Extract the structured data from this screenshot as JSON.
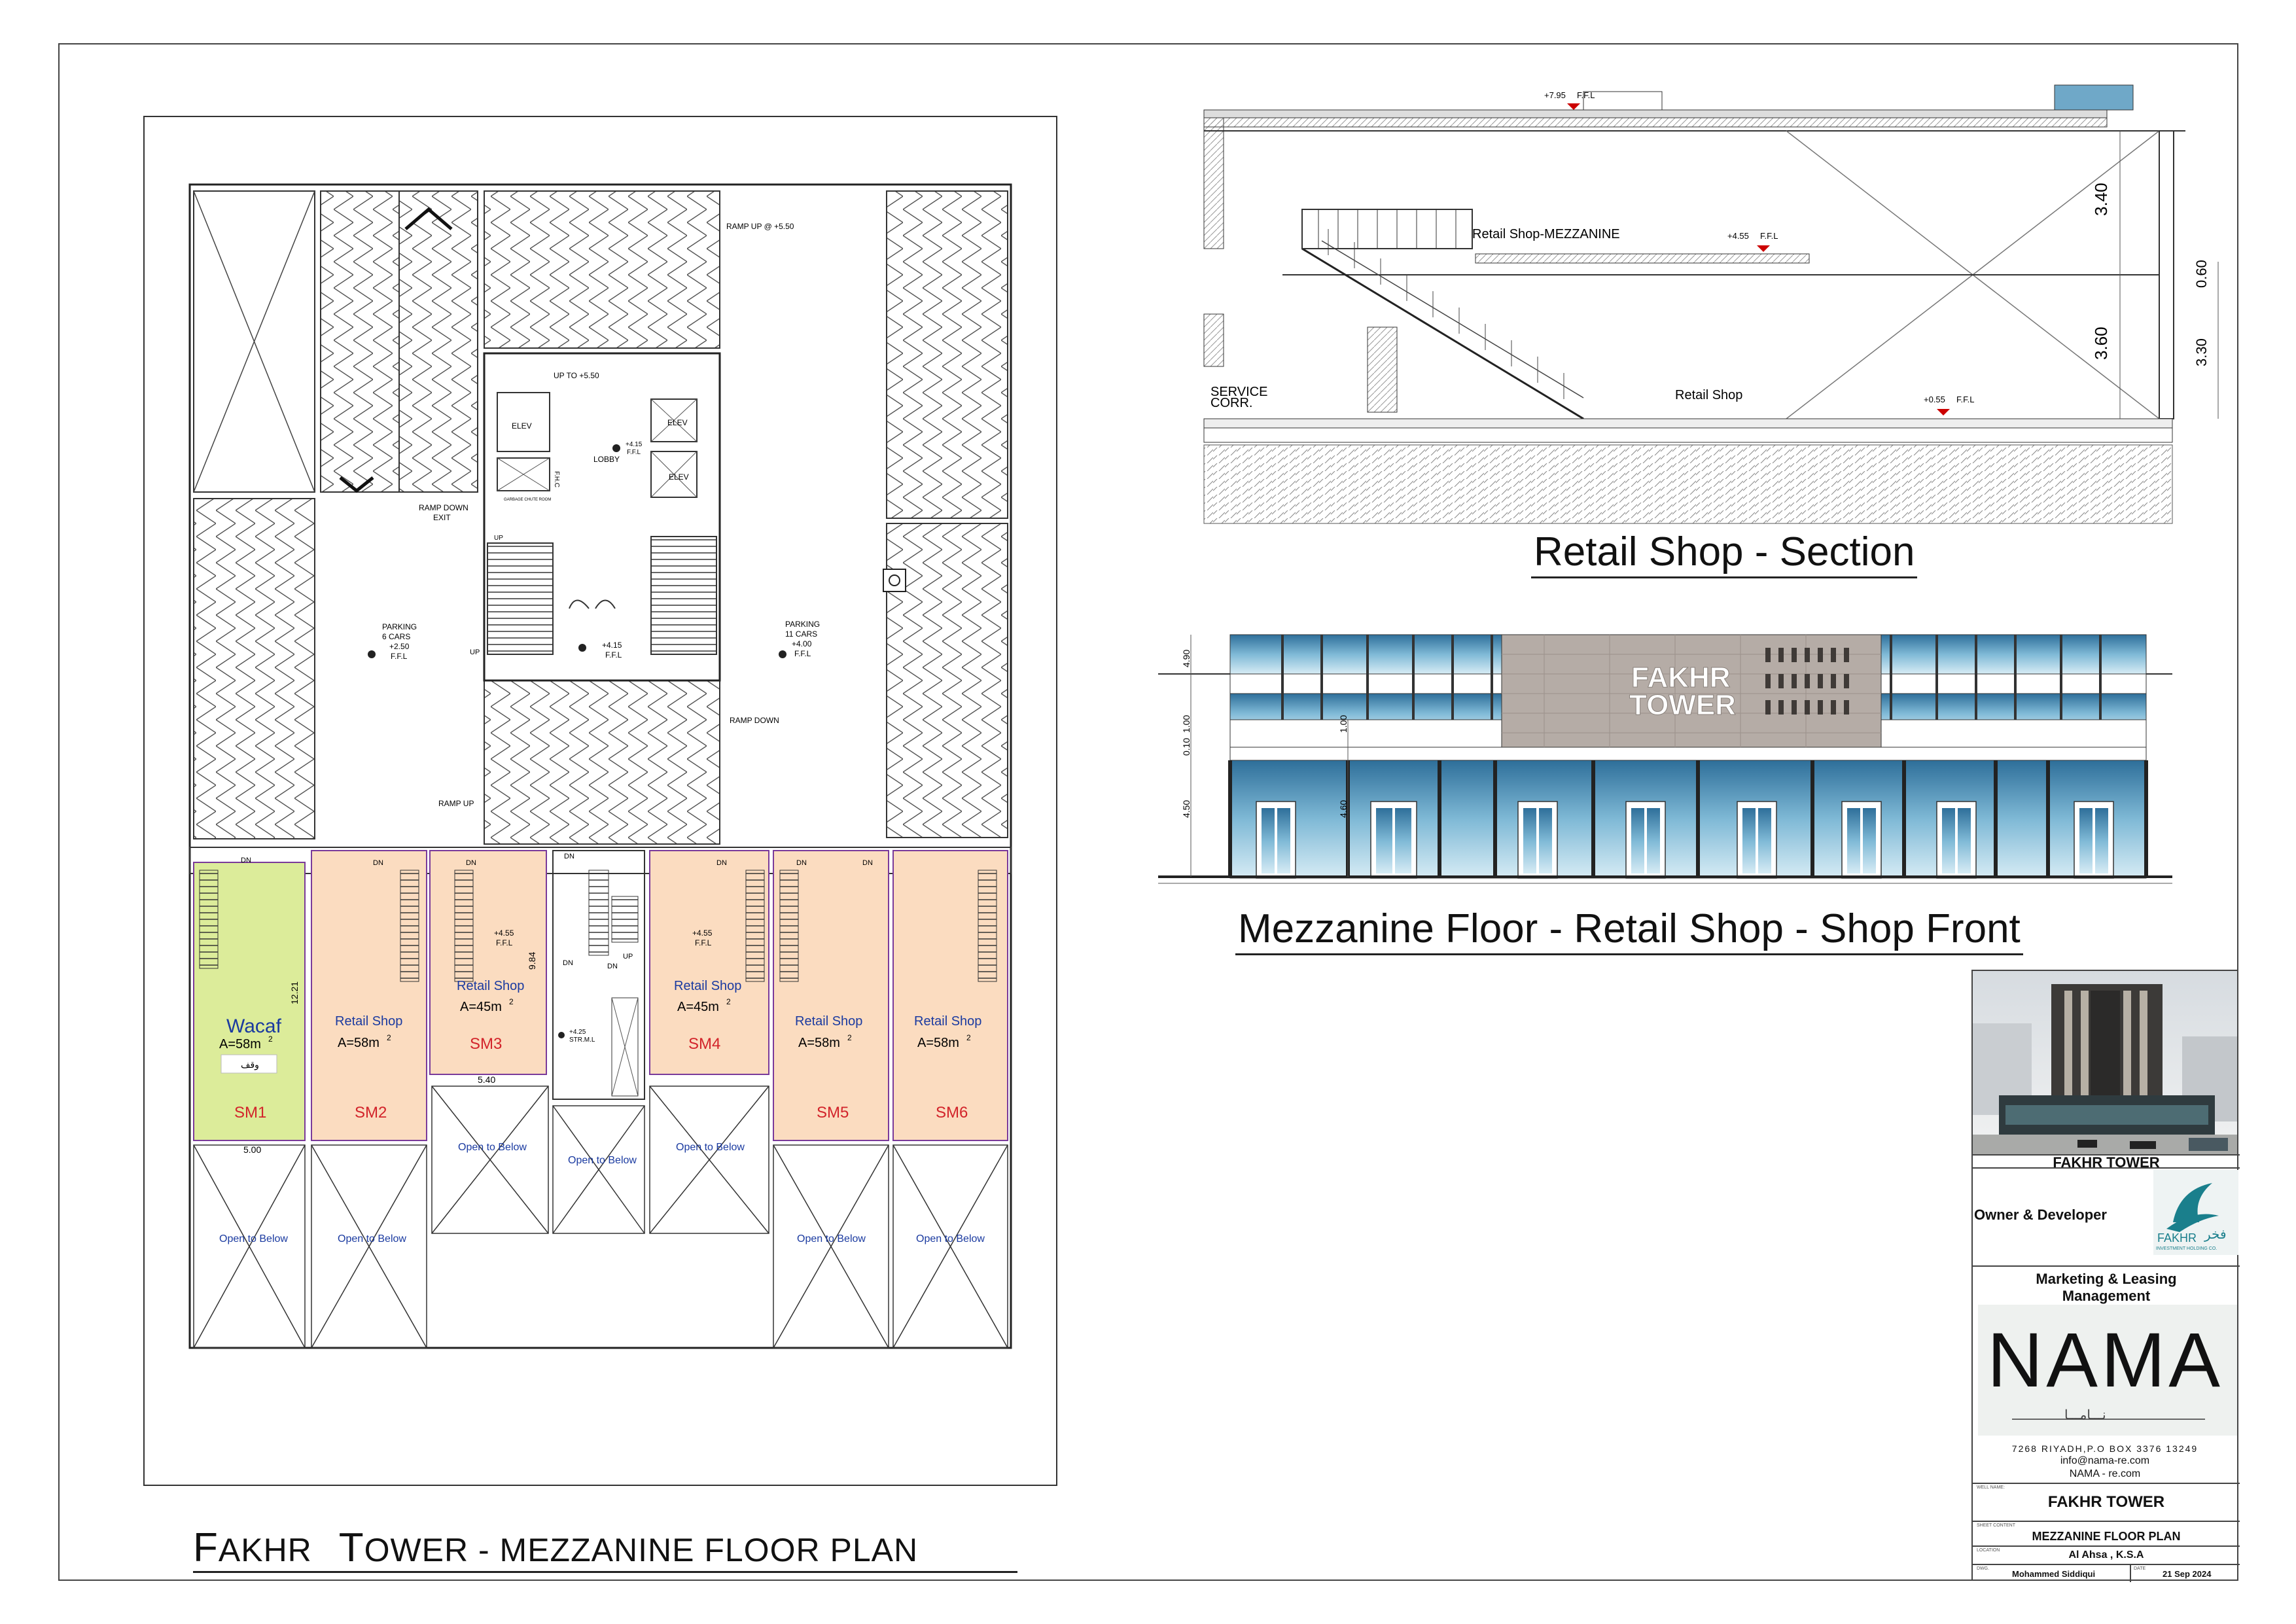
{
  "plan": {
    "title_cap_1": "F",
    "title_rest_1": "AKHR",
    "title_cap_2": "T",
    "title_rest_2": "OWER - MEZZANINE FLOOR PLAN",
    "ramp_up_550": "RAMP UP @ +5.50",
    "up_to_550": "UP TO +5.50",
    "ramp_down_exit_1": "RAMP DOWN",
    "ramp_down_exit_2": "EXIT",
    "ramp_down": "RAMP DOWN",
    "ramp_up": "RAMP UP",
    "lobby": "LOBBY",
    "elev": "ELEV",
    "fhc": "F.H.C",
    "garbage": "GARBAGE CHUTE ROOM",
    "up": "UP",
    "dn": "DN",
    "parking_left": [
      "PARKING",
      "6 CARS"
    ],
    "parking_right": [
      "PARKING",
      "11 CARS"
    ],
    "level_250": "+2.50",
    "level_400": "+4.00",
    "level_415": "+4.15",
    "level_455": "+4.55",
    "level_425": "+4.25",
    "ffl": "F.F.L",
    "strml": "STR.M.L",
    "dim_1221": "12.21",
    "dim_984": "9.84",
    "dim_540": "5.40",
    "dim_500": "5.00",
    "wacaf": "Wacaf",
    "arabic_stamp": "وقف",
    "retail_shop": "Retail Shop",
    "area_58_prefix": "A=58m",
    "area_45_prefix": "A=45m",
    "sup2": "2",
    "units": [
      "SM1",
      "SM2",
      "SM3",
      "SM4",
      "SM5",
      "SM6"
    ],
    "open_below": "Open to Below"
  },
  "section": {
    "title": "Retail Shop - Section",
    "mezz_label": "Retail Shop-MEZZANINE",
    "shop_label": "Retail Shop",
    "service": [
      "SERVICE",
      "CORR."
    ],
    "lvl_795": "+7.95",
    "lvl_455": "+4.55",
    "lvl_055": "+0.55",
    "ffl": "F.F.L",
    "dim_340": "3.40",
    "dim_360": "3.60",
    "dim_060": "0.60",
    "dim_330": "3.30"
  },
  "front": {
    "title": "Mezzanine Floor - Retail Shop - Shop Front",
    "sign_1": "FAKHR",
    "sign_2": "TOWER",
    "dims": [
      "4.90",
      "1.00",
      "0.10",
      "4.50",
      "1.00",
      "4.60"
    ]
  },
  "title_block": {
    "project": "FAKHR TOWER",
    "owner_label": "Owner & Developer",
    "fakhr_logo_ar": "فخر",
    "fakhr_logo_en": "FAKHR",
    "fakhr_logo_sub": "INVESTMENT HOLDING CO.",
    "marketing_label": [
      "Marketing & Leasing",
      "Management"
    ],
    "nama_logo": "NAMA",
    "nama_ar": "نـــامـــا",
    "address": "7268 RIYADH,P.O BOX 3376 13249",
    "email": "info@nama-re.com",
    "web": "NAMA - re.com",
    "project_name": "FAKHR TOWER",
    "sheet": "MEZZANINE FLOOR PLAN",
    "location": "Al Ahsa , K.S.A",
    "drawn_by": "Mohammed Siddiqui",
    "date": "21 Sep 2024",
    "small_labels": [
      "WELL NAME:",
      "SHEET CONTENT",
      "LOCATION",
      "DWG.",
      "DATE"
    ]
  },
  "colors": {
    "wacaf_fill": "#dcec9a",
    "shop_fill": "#fbdcc0",
    "unit_text": "#d2232a",
    "shop_label": "#1a3aa0",
    "glass": "#7fb9d6",
    "teal": "#1a7f8c"
  }
}
